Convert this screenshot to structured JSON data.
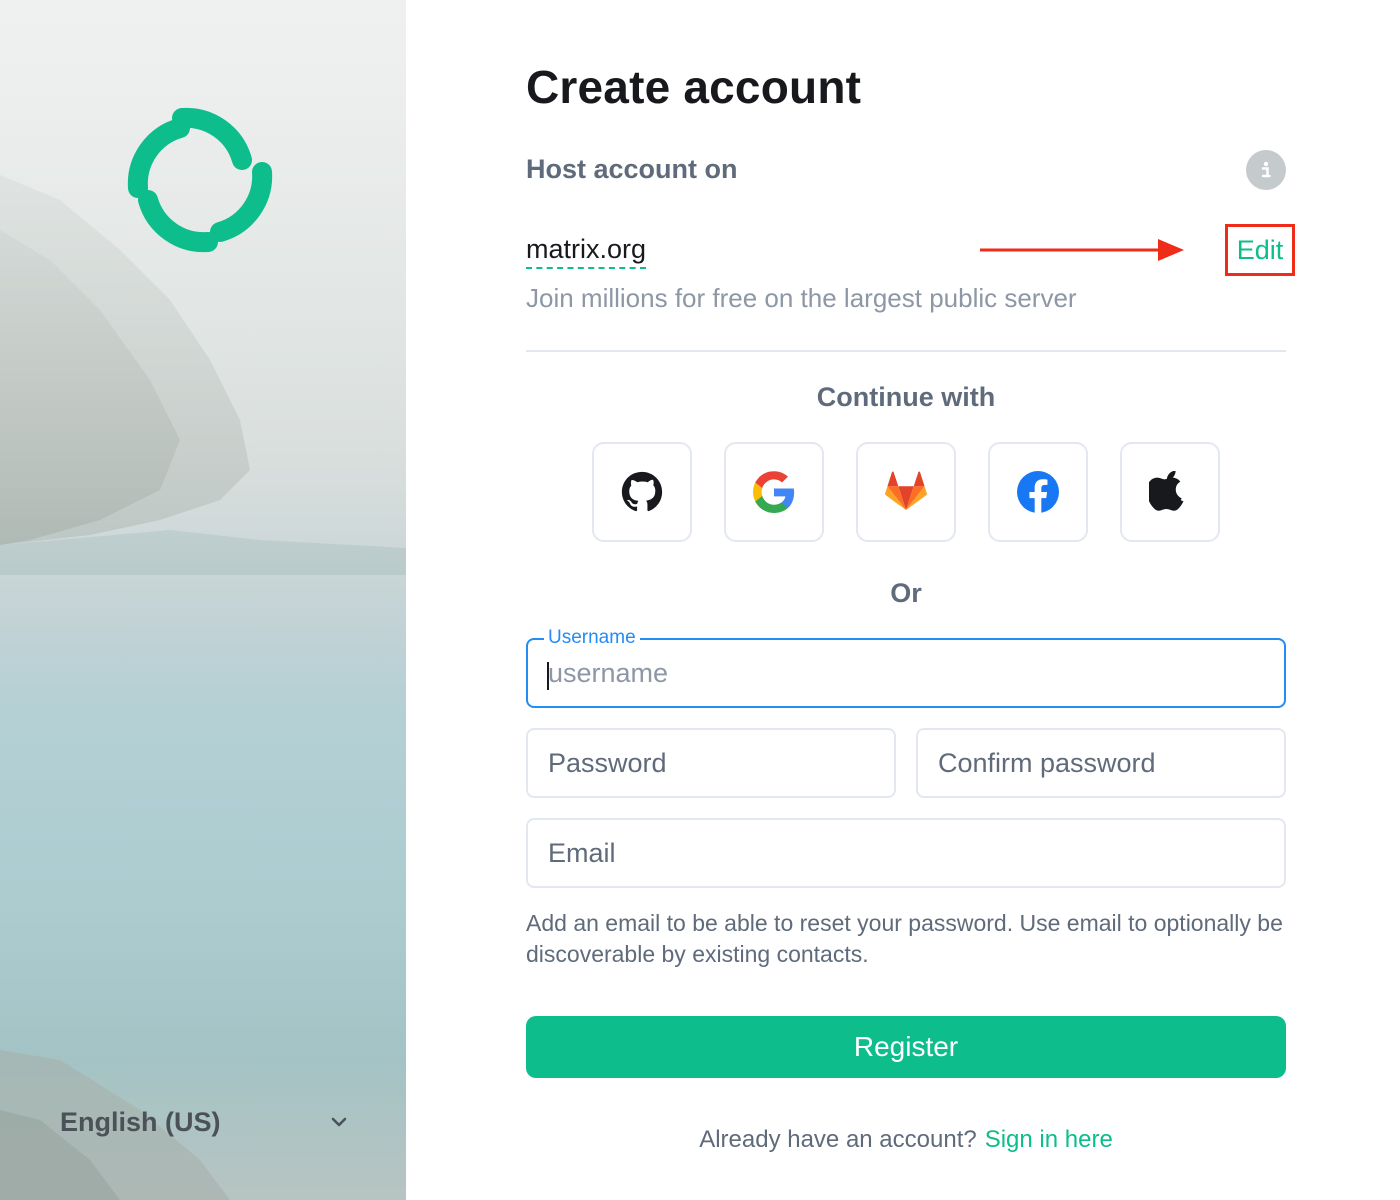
{
  "sidebar": {
    "language": "English (US)"
  },
  "form": {
    "title": "Create account",
    "host_label": "Host account on",
    "server_name": "matrix.org",
    "server_description": "Join millions for free on the largest public server",
    "edit_label": "Edit",
    "continue_with": "Continue with",
    "sso_providers": [
      "github-icon",
      "google-icon",
      "gitlab-icon",
      "facebook-icon",
      "apple-icon"
    ],
    "or_label": "Or",
    "username": {
      "label": "Username",
      "placeholder": "username",
      "value": ""
    },
    "password": {
      "placeholder": "Password",
      "value": ""
    },
    "confirm_password": {
      "placeholder": "Confirm password",
      "value": ""
    },
    "email": {
      "placeholder": "Email",
      "value": ""
    },
    "email_help": "Add an email to be able to reset your password. Use email to optionally be discoverable by existing contacts.",
    "register_label": "Register",
    "signin_prompt": "Already have an account?",
    "signin_link": "Sign in here"
  },
  "colors": {
    "accent": "#0dbd8b",
    "focus": "#238cf5",
    "annotation": "#ef2b1a"
  }
}
